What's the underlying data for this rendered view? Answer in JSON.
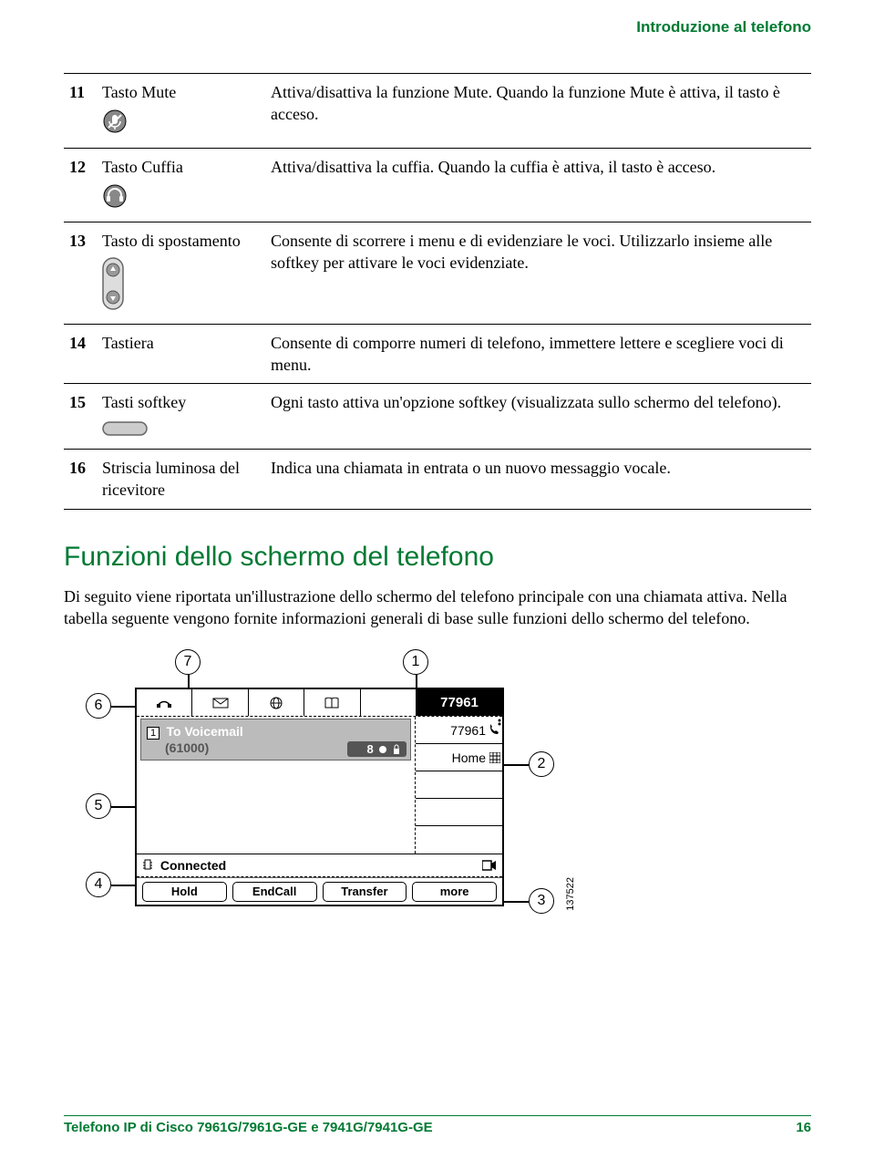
{
  "running_header": "Introduzione al telefono",
  "features": [
    {
      "num": "11",
      "name": "Tasto Mute",
      "icon": "mute",
      "desc": "Attiva/disattiva la funzione Mute. Quando la funzione Mute è attiva, il tasto è acceso."
    },
    {
      "num": "12",
      "name": "Tasto Cuffia",
      "icon": "headset",
      "desc": "Attiva/disattiva la cuffia. Quando la cuffia è attiva, il tasto è acceso."
    },
    {
      "num": "13",
      "name": "Tasto di spostamento",
      "icon": "nav",
      "desc": "Consente di scorrere i menu e di evidenziare le voci. Utilizzarlo insieme alle softkey per attivare le voci evidenziate."
    },
    {
      "num": "14",
      "name": "Tastiera",
      "icon": "",
      "desc": "Consente di comporre numeri di telefono, immettere lettere e scegliere voci di menu."
    },
    {
      "num": "15",
      "name": "Tasti softkey",
      "icon": "softkey",
      "desc": "Ogni tasto attiva un'opzione softkey (visualizzata sullo schermo del telefono)."
    },
    {
      "num": "16",
      "name": "Striscia luminosa del ricevitore",
      "icon": "",
      "desc": "Indica una chiamata in entrata o un nuovo messaggio vocale."
    }
  ],
  "section_heading": "Funzioni dello schermo del telefono",
  "section_text": "Di seguito viene riportata un'illustrazione dello schermo del telefono principale con una chiamata attiva. Nella tabella seguente vengono fornite informazioni generali di base sulle funzioni dello schermo del telefono.",
  "diagram": {
    "callouts": [
      "1",
      "2",
      "3",
      "4",
      "5",
      "6",
      "7"
    ],
    "ext_main": "77961",
    "line_ext": "77961",
    "line_home": "Home",
    "call_idx": "1",
    "call_title": "To Voicemail",
    "call_sub": "(61000)",
    "call_indicator": "8",
    "status_text": "Connected",
    "softkeys": [
      "Hold",
      "EndCall",
      "Transfer",
      "more"
    ],
    "figure_id": "137522"
  },
  "footer": {
    "title": "Telefono IP di Cisco 7961G/7961G-GE e 7941G/7941G-GE",
    "page": "16"
  }
}
